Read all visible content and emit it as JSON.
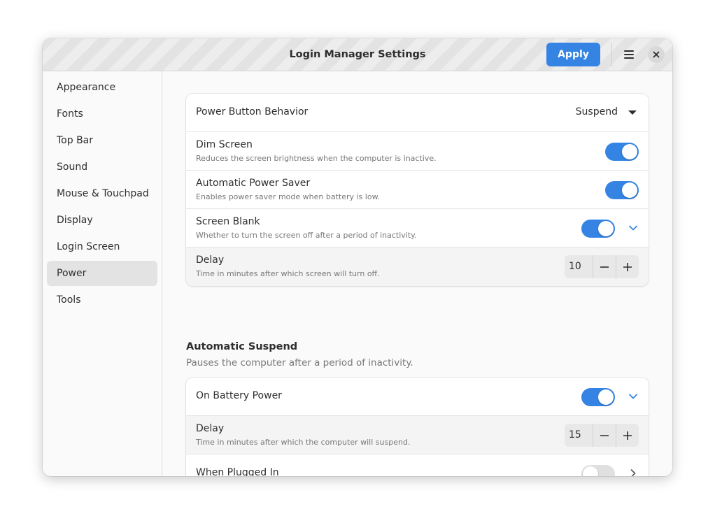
{
  "window": {
    "title": "Login Manager Settings",
    "apply_label": "Apply"
  },
  "colors": {
    "accent": "#3584e4",
    "toggle_off": "#e0e0e0"
  },
  "sidebar": {
    "items": [
      {
        "label": "Appearance",
        "active": false
      },
      {
        "label": "Fonts",
        "active": false
      },
      {
        "label": "Top Bar",
        "active": false
      },
      {
        "label": "Sound",
        "active": false
      },
      {
        "label": "Mouse & Touchpad",
        "active": false
      },
      {
        "label": "Display",
        "active": false
      },
      {
        "label": "Login Screen",
        "active": false
      },
      {
        "label": "Power",
        "active": true
      },
      {
        "label": "Tools",
        "active": false
      }
    ]
  },
  "power": {
    "power_button": {
      "label": "Power Button Behavior",
      "value": "Suspend"
    },
    "dim_screen": {
      "label": "Dim Screen",
      "description": "Reduces the screen brightness when the computer is inactive.",
      "enabled": true
    },
    "power_saver": {
      "label": "Automatic Power Saver",
      "description": "Enables power saver mode when battery is low.",
      "enabled": true
    },
    "screen_blank": {
      "label": "Screen Blank",
      "description": "Whether to turn the screen off after a period of inactivity.",
      "enabled": true,
      "expanded": true
    },
    "blank_delay": {
      "label": "Delay",
      "description": "Time in minutes after which screen will turn off.",
      "value": "10"
    }
  },
  "auto_suspend": {
    "title": "Automatic Suspend",
    "subtitle": "Pauses the computer after a period of inactivity.",
    "battery": {
      "label": "On Battery Power",
      "enabled": true,
      "expanded": true
    },
    "battery_delay": {
      "label": "Delay",
      "description": "Time in minutes after which the computer will suspend.",
      "value": "15"
    },
    "plugged_in": {
      "label": "When Plugged In",
      "enabled": false
    }
  },
  "icons": {
    "menu": "hamburger-menu-icon",
    "close": "close-icon",
    "dropdown": "triangle-down-icon",
    "expand": "chevron-down-icon",
    "navigate": "chevron-right-icon",
    "decrement": "minus-icon",
    "increment": "plus-icon"
  }
}
